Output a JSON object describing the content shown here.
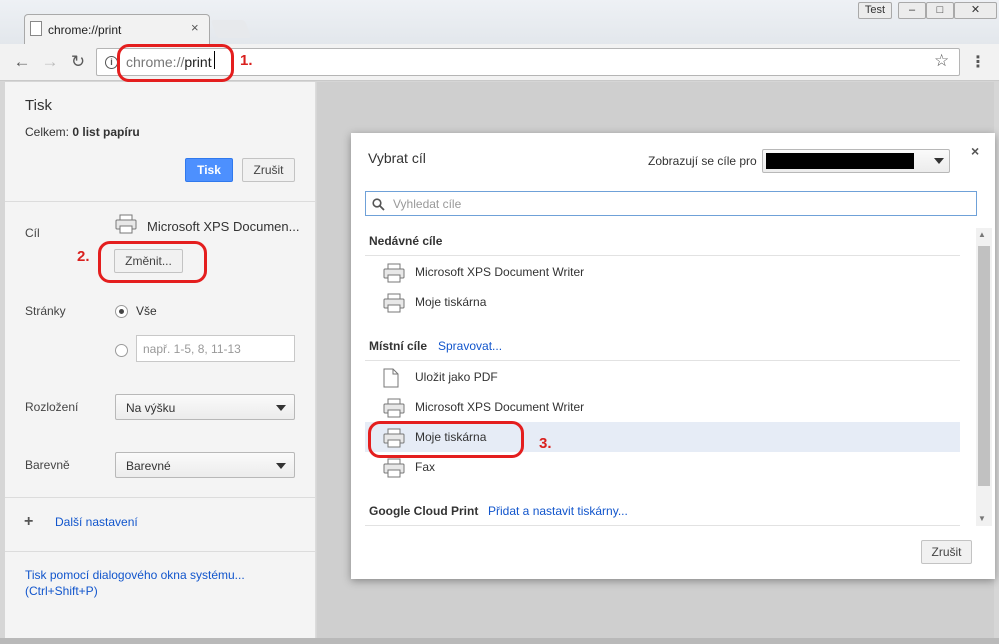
{
  "window": {
    "user_badge": "Test",
    "min_label": "–",
    "max_label": "□",
    "close_label": "✕"
  },
  "tab": {
    "title": "chrome://print",
    "close": "×"
  },
  "toolbar": {
    "back": "←",
    "forward": "→",
    "reload": "↻",
    "url_scheme": "chrome://",
    "url_path": "print",
    "info": "i",
    "star": "☆",
    "menu": "⋮"
  },
  "print_panel": {
    "title": "Tisk",
    "total_label": "Celkem:",
    "total_value": "0 list papíru",
    "print_button": "Tisk",
    "cancel_button": "Zrušit",
    "destination_label": "Cíl",
    "destination_name": "Microsoft XPS Documen...",
    "change_button": "Změnit...",
    "pages_label": "Stránky",
    "pages_all": "Vše",
    "pages_placeholder": "např. 1-5, 8, 11-13",
    "layout_label": "Rozložení",
    "layout_value": "Na výšku",
    "color_label": "Barevně",
    "color_value": "Barevné",
    "more_settings": "Další nastavení",
    "system_dialog_link": "Tisk pomocí dialogového okna systému... (Ctrl+Shift+P)"
  },
  "dialog": {
    "title": "Vybrat cíl",
    "close": "×",
    "showing_for": "Zobrazují se cíle pro",
    "search_placeholder": "Vyhledat cíle",
    "recent_title": "Nedávné cíle",
    "recent": [
      {
        "name": "Microsoft XPS Document Writer",
        "icon": "printer-icon"
      },
      {
        "name": "Moje tiskárna",
        "icon": "printer-icon"
      }
    ],
    "local_title": "Místní cíle",
    "local_manage": "Spravovat...",
    "local": [
      {
        "name": "Uložit jako PDF",
        "icon": "pdf-icon"
      },
      {
        "name": "Microsoft XPS Document Writer",
        "icon": "printer-icon"
      },
      {
        "name": "Moje tiskárna",
        "icon": "printer-icon",
        "selected": true
      },
      {
        "name": "Fax",
        "icon": "printer-icon"
      }
    ],
    "cloud_title": "Google Cloud Print",
    "cloud_link": "Přidat a nastavit tiskárny...",
    "cancel_button": "Zrušit"
  },
  "annotations": {
    "step1": "1.",
    "step2": "2.",
    "step3": "3.",
    "color": "#e41e1e"
  },
  "colors": {
    "accent_blue": "#4d90fe",
    "link": "#1155cc",
    "selected_row": "#e6ecf6"
  }
}
